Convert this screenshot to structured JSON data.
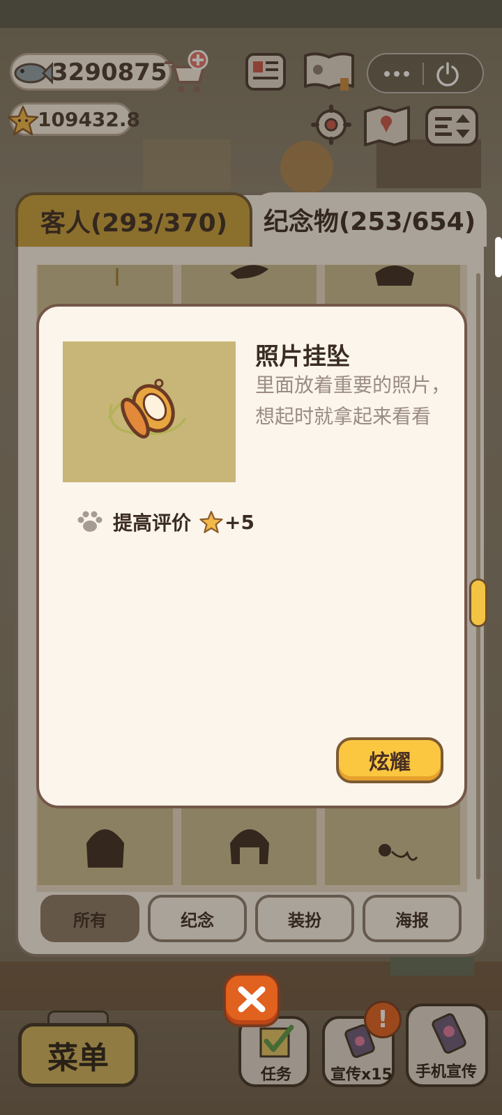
{
  "currency": {
    "fish": "3290875",
    "stars": "109432.8"
  },
  "tabs": [
    {
      "label": "客人(293/370)",
      "active": false
    },
    {
      "label": "纪念物(253/654)",
      "active": true
    }
  ],
  "item": {
    "title": "照片挂坠",
    "description": "里面放着重要的照片，想起时就拿起来看看",
    "effect_label": "提高评价",
    "effect_value": "+5",
    "action_label": "炫耀"
  },
  "filters": [
    {
      "label": "所有",
      "active": true
    },
    {
      "label": "纪念",
      "active": false
    },
    {
      "label": "装扮",
      "active": false
    },
    {
      "label": "海报",
      "active": false
    }
  ],
  "bottom_bar": {
    "menu_label": "菜单",
    "tasks_label": "任务",
    "promote_label": "宣传x15",
    "alert_badge": "!",
    "phone_promote_label": "手机宣传"
  },
  "colors": {
    "accent_yellow": "#fbc740",
    "active_tab": "#c9a13a",
    "close_orange": "#e1611f",
    "panel_bg": "#faf4ea"
  }
}
